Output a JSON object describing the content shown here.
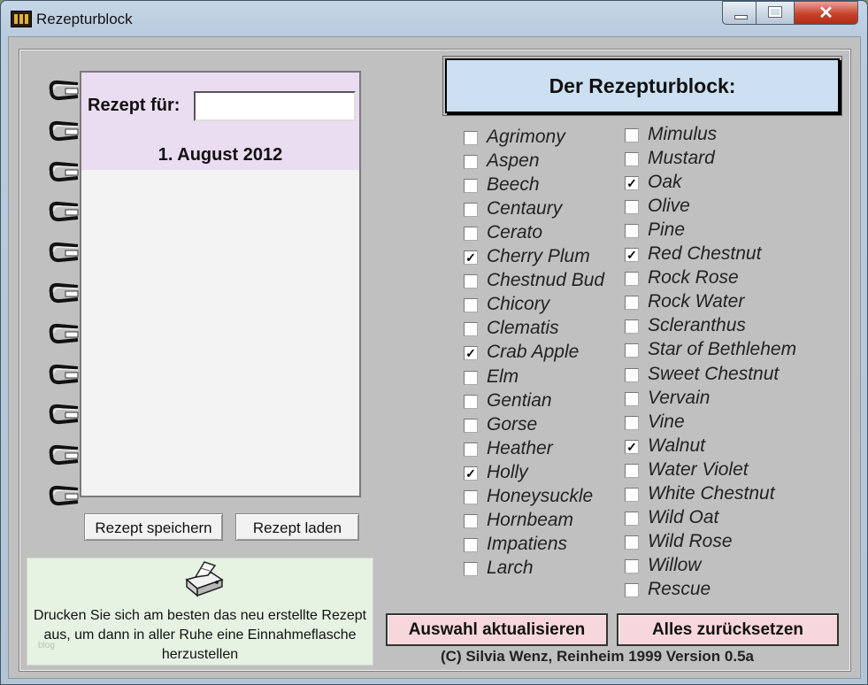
{
  "window": {
    "title": "Rezepturblock"
  },
  "notebook": {
    "rezept_label": "Rezept für:",
    "rezept_value": "",
    "date": "1. August 2012"
  },
  "buttons": {
    "save": "Rezept speichern",
    "load": "Rezept laden"
  },
  "print_box": {
    "text": "Drucken Sie sich am besten das neu erstellte Rezept aus, um dann in aller Ruhe eine Einnahmeflasche herzustellen",
    "watermark": "blog"
  },
  "heading": "Der Rezepturblock:",
  "remedies_left": [
    {
      "label": "Agrimony",
      "checked": false
    },
    {
      "label": "Aspen",
      "checked": false
    },
    {
      "label": "Beech",
      "checked": false
    },
    {
      "label": "Centaury",
      "checked": false
    },
    {
      "label": "Cerato",
      "checked": false
    },
    {
      "label": "Cherry Plum",
      "checked": true
    },
    {
      "label": "Chestnud Bud",
      "checked": false
    },
    {
      "label": "Chicory",
      "checked": false
    },
    {
      "label": "Clematis",
      "checked": false
    },
    {
      "label": "Crab Apple",
      "checked": true
    },
    {
      "label": "Elm",
      "checked": false
    },
    {
      "label": "Gentian",
      "checked": false
    },
    {
      "label": "Gorse",
      "checked": false
    },
    {
      "label": "Heather",
      "checked": false
    },
    {
      "label": "Holly",
      "checked": true
    },
    {
      "label": "Honeysuckle",
      "checked": false
    },
    {
      "label": "Hornbeam",
      "checked": false
    },
    {
      "label": "Impatiens",
      "checked": false
    },
    {
      "label": "Larch",
      "checked": false
    }
  ],
  "remedies_right": [
    {
      "label": "Mimulus",
      "checked": false
    },
    {
      "label": "Mustard",
      "checked": false
    },
    {
      "label": "Oak",
      "checked": true
    },
    {
      "label": "Olive",
      "checked": false
    },
    {
      "label": "Pine",
      "checked": false
    },
    {
      "label": "Red Chestnut",
      "checked": true
    },
    {
      "label": "Rock Rose",
      "checked": false
    },
    {
      "label": "Rock Water",
      "checked": false
    },
    {
      "label": "Scleranthus",
      "checked": false
    },
    {
      "label": "Star of Bethlehem",
      "checked": false
    },
    {
      "label": "Sweet Chestnut",
      "checked": false
    },
    {
      "label": "Vervain",
      "checked": false
    },
    {
      "label": "Vine",
      "checked": false
    },
    {
      "label": "Walnut",
      "checked": true
    },
    {
      "label": "Water Violet",
      "checked": false
    },
    {
      "label": "White Chestnut",
      "checked": false
    },
    {
      "label": "Wild Oat",
      "checked": false
    },
    {
      "label": "Wild Rose",
      "checked": false
    },
    {
      "label": "Willow",
      "checked": false
    },
    {
      "label": "Rescue",
      "checked": false
    }
  ],
  "actions": {
    "update": "Auswahl aktualisieren",
    "reset": "Alles zurücksetzen"
  },
  "footer": "(C) Silvia Wenz, Reinheim 1999     Version 0.5a"
}
